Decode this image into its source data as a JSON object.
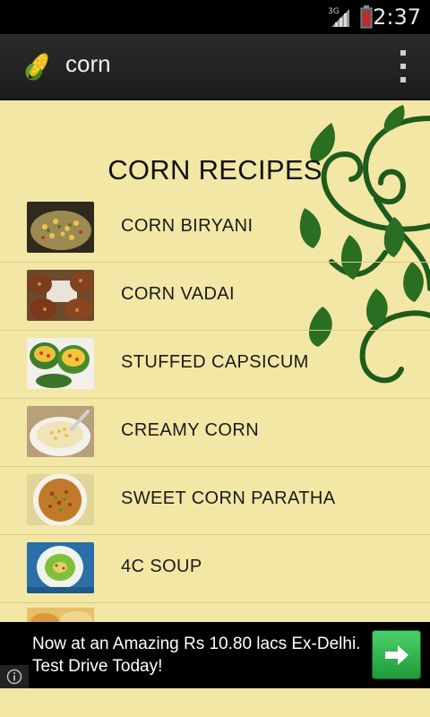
{
  "status_bar": {
    "network": "3G",
    "time": "2:37"
  },
  "app_bar": {
    "icon": "corn-icon",
    "title": "corn",
    "menu_icon": "overflow-menu-icon"
  },
  "content": {
    "heading": "CORN RECIPES",
    "recipes": [
      {
        "label": "CORN BIRYANI"
      },
      {
        "label": "CORN VADAI"
      },
      {
        "label": "STUFFED CAPSICUM"
      },
      {
        "label": "CREAMY CORN"
      },
      {
        "label": "SWEET CORN PARATHA"
      },
      {
        "label": "4C SOUP"
      }
    ]
  },
  "ad": {
    "text": "Now at an Amazing Rs 10.80 lacs Ex-Delhi. Test Drive Today!",
    "button_icon": "arrow-right-icon",
    "info_icon": "info-icon"
  },
  "colors": {
    "background": "#f3e7a6",
    "app_bar": "#222222",
    "accent_green": "#2e9e45",
    "leaf_green": "#1e5a1a"
  }
}
